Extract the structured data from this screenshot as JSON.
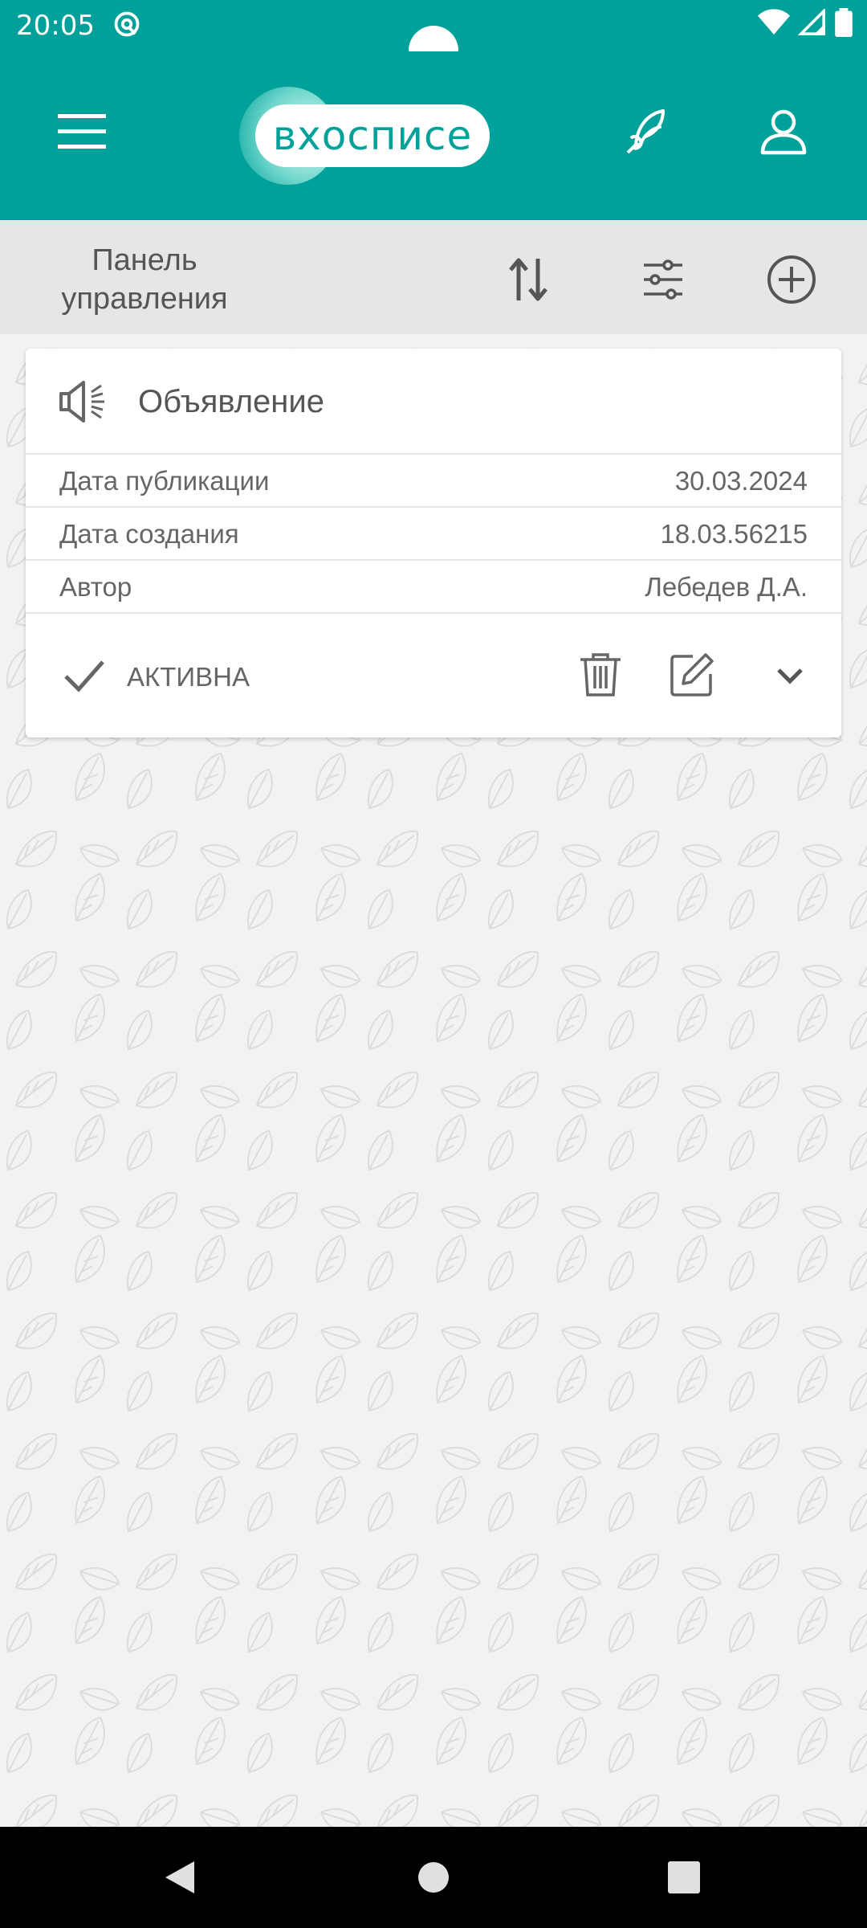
{
  "status": {
    "time": "20:05"
  },
  "app": {
    "logo_text": "вхосписе"
  },
  "toolbar": {
    "title": "Панель управления"
  },
  "card": {
    "title": "Объявление",
    "rows": [
      {
        "label": "Дата публикации",
        "value": "30.03.2024"
      },
      {
        "label": "Дата создания",
        "value": "18.03.56215"
      },
      {
        "label": "Автор",
        "value": "Лебедев Д.А."
      }
    ],
    "status_label": "АКТИВНА"
  },
  "colors": {
    "primary": "#00a19a",
    "toolbar_bg": "#e6e6e6",
    "page_bg": "#f2f2f2"
  },
  "icons": [
    "menu-icon",
    "quill-icon",
    "profile-icon",
    "sort-icon",
    "filter-icon",
    "add-circle-icon",
    "megaphone-icon",
    "check-icon",
    "trash-icon",
    "edit-icon",
    "chevron-down-icon",
    "back-icon",
    "home-icon",
    "recents-icon"
  ]
}
